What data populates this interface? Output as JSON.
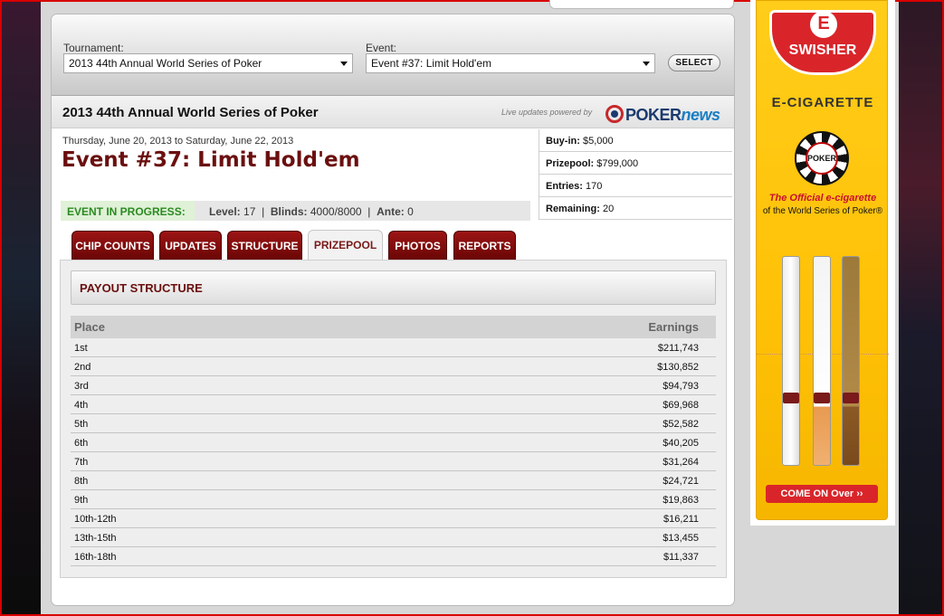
{
  "selector": {
    "tournament_label": "Tournament:",
    "tournament_value": "2013 44th Annual World Series of Poker",
    "event_label": "Event:",
    "event_value": "Event #37: Limit Hold'em",
    "select_button": "SELECT"
  },
  "title_bar": {
    "title": "2013 44th Annual World Series of Poker",
    "powered_text": "Live updates powered by",
    "logo_text_a": "POKER",
    "logo_text_b": "news"
  },
  "event": {
    "dates": "Thursday, June 20, 2013 to Saturday, June 22, 2013",
    "title": "Event #37: Limit Hold'em"
  },
  "info": [
    {
      "label": "Buy-in:",
      "value": "$5,000"
    },
    {
      "label": "Prizepool:",
      "value": "$799,000"
    },
    {
      "label": "Entries:",
      "value": "170"
    },
    {
      "label": "Remaining:",
      "value": "20"
    }
  ],
  "status": {
    "badge": "EVENT IN PROGRESS:",
    "level_label": "Level:",
    "level_value": "17",
    "blinds_label": "Blinds:",
    "blinds_value": "4000/8000",
    "ante_label": "Ante:",
    "ante_value": "0",
    "separator": "|"
  },
  "tabs": [
    {
      "label": "CHIP COUNTS",
      "active": false
    },
    {
      "label": "UPDATES",
      "active": false
    },
    {
      "label": "STRUCTURE",
      "active": false
    },
    {
      "label": "PRIZEPOOL",
      "active": true
    },
    {
      "label": "PHOTOS",
      "active": false
    },
    {
      "label": "REPORTS",
      "active": false
    }
  ],
  "payout": {
    "header": "PAYOUT STRUCTURE",
    "col_place": "Place",
    "col_earnings": "Earnings",
    "rows": [
      {
        "place": "1st",
        "earnings": "$211,743"
      },
      {
        "place": "2nd",
        "earnings": "$130,852"
      },
      {
        "place": "3rd",
        "earnings": "$94,793"
      },
      {
        "place": "4th",
        "earnings": "$69,968"
      },
      {
        "place": "5th",
        "earnings": "$52,582"
      },
      {
        "place": "6th",
        "earnings": "$40,205"
      },
      {
        "place": "7th",
        "earnings": "$31,264"
      },
      {
        "place": "8th",
        "earnings": "$24,721"
      },
      {
        "place": "9th",
        "earnings": "$19,863"
      },
      {
        "place": "10th-12th",
        "earnings": "$16,211"
      },
      {
        "place": "13th-15th",
        "earnings": "$13,455"
      },
      {
        "place": "16th-18th",
        "earnings": "$11,337"
      }
    ]
  },
  "ad": {
    "brand": "SWISHER",
    "emblem": "E",
    "product": "E-CIGARETTE",
    "chip_text": "POKER",
    "official": "The Official e-cigarette",
    "wsop": "of the World Series of Poker®",
    "cta": "COME ON Over ››"
  },
  "colors": {
    "brand_red": "#6b0f0f",
    "tab_red": "#8a0c0c",
    "status_green": "#2b8a23",
    "ad_yellow": "#ffc107"
  }
}
